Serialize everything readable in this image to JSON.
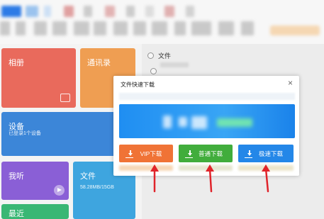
{
  "tiles": {
    "photos": {
      "label": "相册"
    },
    "contacts": {
      "label": "通讯录"
    },
    "devices": {
      "label": "设备",
      "sub": "已登录1个设备"
    },
    "listen": {
      "label": "我听"
    },
    "files": {
      "label": "文件",
      "sub": "58.28MB/15GB"
    },
    "recent": {
      "label": "最近"
    }
  },
  "right_panel": {
    "radio_label": "文件"
  },
  "dialog": {
    "title": "文件快速下载",
    "close": "×",
    "buttons": {
      "vip": "VIP下载",
      "normal": "普通下载",
      "fast": "极速下载"
    }
  },
  "colors": {
    "vip": "#f07336",
    "normal": "#41ad3c",
    "fast": "#2487e8",
    "annotation_arrow": "#e0242b"
  }
}
